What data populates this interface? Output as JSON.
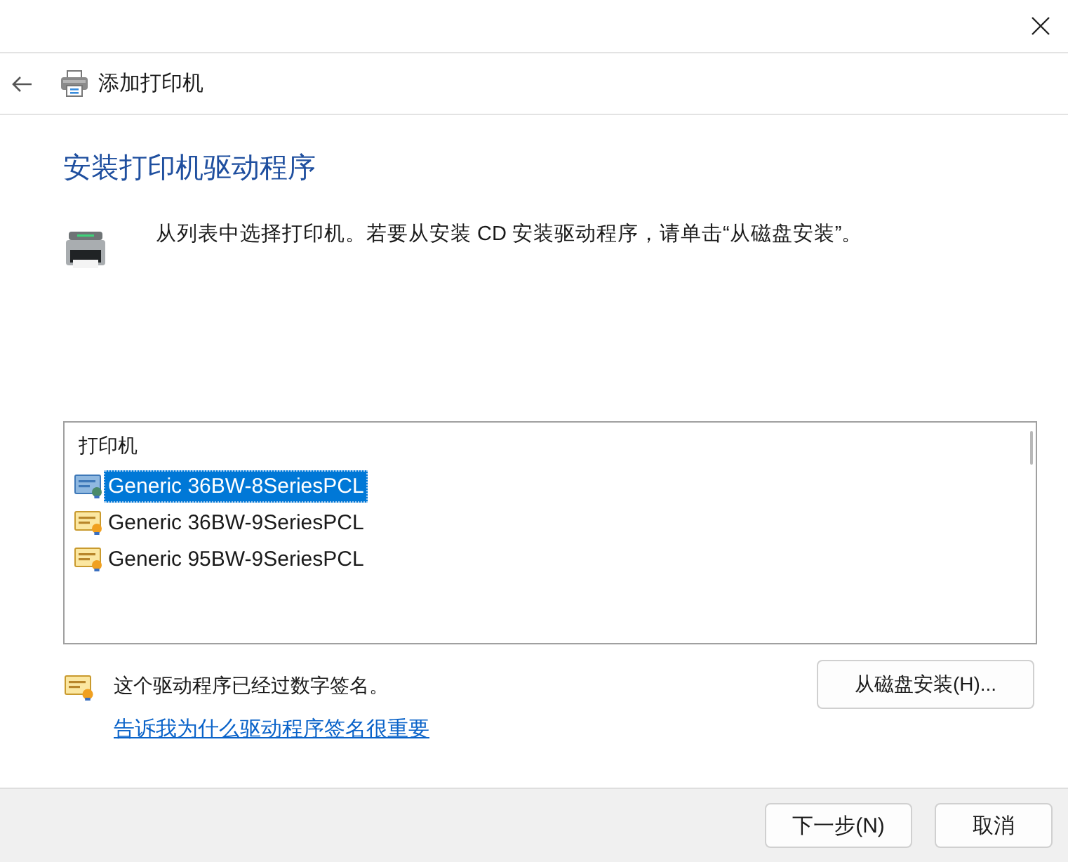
{
  "window": {
    "title": "添加打印机"
  },
  "heading": "安装打印机驱动程序",
  "instruction": "从列表中选择打印机。若要从安装 CD 安装驱动程序，请单击“从磁盘安装”。",
  "printer_list": {
    "header": "打印机",
    "items": [
      {
        "label": "Generic 36BW-8SeriesPCL",
        "selected": true
      },
      {
        "label": "Generic 36BW-9SeriesPCL",
        "selected": false
      },
      {
        "label": "Generic 95BW-9SeriesPCL",
        "selected": false
      }
    ]
  },
  "signature": {
    "text": "这个驱动程序已经过数字签名。",
    "link": "告诉我为什么驱动程序签名很重要"
  },
  "buttons": {
    "have_disk": "从磁盘安装(H)...",
    "next": "下一步(N)",
    "cancel": "取消"
  }
}
